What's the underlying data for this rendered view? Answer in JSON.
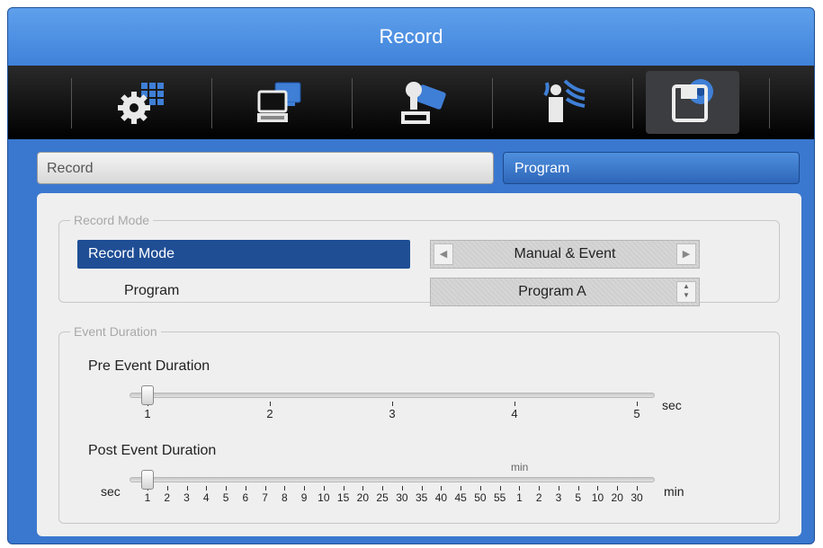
{
  "window": {
    "title": "Record"
  },
  "toolbar": {
    "icons": [
      {
        "name": "system-settings-icon"
      },
      {
        "name": "network-icon"
      },
      {
        "name": "camera-icon"
      },
      {
        "name": "alarm-sensor-icon"
      },
      {
        "name": "record-storage-icon",
        "selected": true
      }
    ]
  },
  "tabs": {
    "record": "Record",
    "program": "Program"
  },
  "record_mode_group": {
    "legend": "Record Mode",
    "record_mode_label": "Record Mode",
    "record_mode_value": "Manual & Event",
    "program_label": "Program",
    "program_value": "Program A"
  },
  "event_duration_group": {
    "legend": "Event Duration",
    "pre": {
      "label": "Pre Event Duration",
      "ticks": [
        "1",
        "2",
        "3",
        "4",
        "5"
      ],
      "unit": "sec",
      "value": "1"
    },
    "post": {
      "label": "Post Event Duration",
      "prefix_unit": "sec",
      "mid_unit": "min",
      "ticks": [
        "1",
        "2",
        "3",
        "4",
        "5",
        "6",
        "7",
        "8",
        "9",
        "10",
        "15",
        "20",
        "25",
        "30",
        "35",
        "40",
        "45",
        "50",
        "55",
        "1",
        "2",
        "3",
        "5",
        "10",
        "20",
        "30"
      ],
      "unit": "min",
      "value": "1"
    }
  },
  "colors": {
    "accent": "#3a78cf",
    "selected_row": "#1f4e95",
    "tab_active": "#2e66b8"
  }
}
